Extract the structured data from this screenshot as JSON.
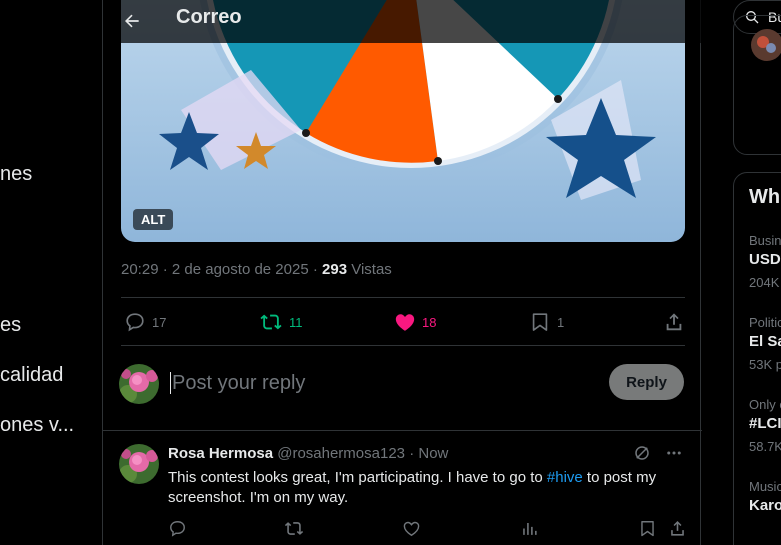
{
  "left_nav": {
    "items": [
      "nes",
      "es",
      "calidad",
      "ones v..."
    ]
  },
  "header": {
    "title": "Correo",
    "back_icon": "arrow-left-icon"
  },
  "media": {
    "alt_label": "ALT"
  },
  "tweet_meta": {
    "time": "20:29",
    "date": "2 de agosto de 2025",
    "views_count": "293",
    "views_label": "Vistas"
  },
  "actions": {
    "replies": "17",
    "reposts": "11",
    "likes": "18",
    "bookmarks": "1"
  },
  "reply_box": {
    "placeholder": "Post your reply",
    "button_label": "Reply"
  },
  "reply_post": {
    "name": "Rosa Hermosa",
    "handle": "@rosahermosa123",
    "time": "Now",
    "text_before": "This contest looks great, I'm participating. I have to go to ",
    "hashtag": "#hive",
    "text_after": " to post my screenshot. I'm on my way."
  },
  "right_sidebar": {
    "search_placeholder": "Bu",
    "whats_heading": "Wh",
    "trends": [
      {
        "category": "Busin",
        "title": "USD",
        "count": "204K"
      },
      {
        "category": "Politic",
        "title": "El Sa",
        "count": "53K p"
      },
      {
        "category": "Only o",
        "title": "#LCI",
        "count": "58.7K"
      },
      {
        "category": "Music",
        "title": "Karo",
        "count": ""
      }
    ]
  },
  "colors": {
    "accent": "#1d9bf0",
    "repost_green": "#00ba7c",
    "like_pink": "#f91880",
    "wheel_orange": "#ff5a00",
    "wheel_teal": "#1597b6"
  }
}
